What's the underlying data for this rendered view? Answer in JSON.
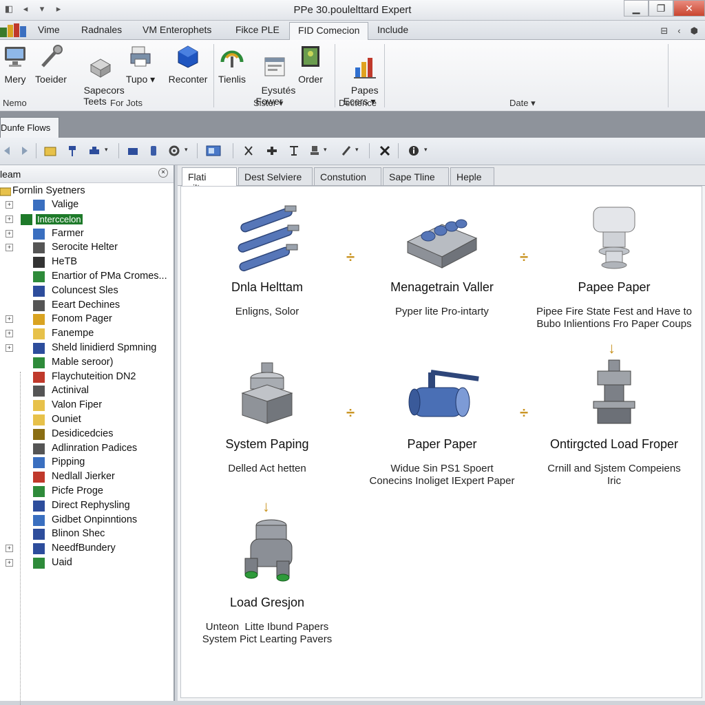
{
  "app": {
    "title": "PPe 30.poulelttard Expert"
  },
  "ribbon_tabs": [
    "Vime",
    "Radnales",
    "VM Enterophets",
    "Fikce PLE",
    "FID Comecion",
    "Include"
  ],
  "ribbon": {
    "buttons": [
      {
        "label": "Mery",
        "icon": "monitor-icon"
      },
      {
        "label": "Toeider",
        "icon": "wrench-icon"
      },
      {
        "label": "Sapecors\nTeets",
        "icon": "box-icon"
      },
      {
        "label": "Tupo ▾",
        "icon": "printer-icon"
      },
      {
        "label": "Reconter",
        "icon": "cube-icon"
      },
      {
        "label": "Tienlis",
        "icon": "gauge-icon"
      },
      {
        "label": "Eysutés\nFower",
        "icon": "window-icon"
      },
      {
        "label": "Order",
        "icon": "photo-icon"
      },
      {
        "label": "Papes\nEcers ▾",
        "icon": "chart-icon"
      }
    ],
    "groups": [
      "Nemo",
      "For Jots",
      "Sister ▾",
      "Dectence",
      "Date ▾"
    ]
  },
  "doc_tab": "Dunfe Flows",
  "tree": {
    "header": "leam",
    "root": "Fornlin Syetners",
    "items": [
      {
        "label": "Valige",
        "expander": true
      },
      {
        "label": "Interccelon",
        "expander": true,
        "selected": true
      },
      {
        "label": "Farmer",
        "expander": true
      },
      {
        "label": "Serocite Helter",
        "expander": true
      },
      {
        "label": "HeTB",
        "expander": false
      },
      {
        "label": "Enartior of PMa Cromes...",
        "expander": false
      },
      {
        "label": "Coluncest Sles",
        "expander": false
      },
      {
        "label": "Eeart Dechines",
        "expander": false
      },
      {
        "label": "Fonom Pager",
        "expander": true
      },
      {
        "label": "Fanempe",
        "expander": true
      },
      {
        "label": "Sheld linidierd Spmning",
        "expander": true
      },
      {
        "label": "Mable seroor)",
        "expander": false
      },
      {
        "label": "Flaychuteition DN2",
        "expander": false
      },
      {
        "label": "Actinival",
        "expander": false
      },
      {
        "label": "Valon Fiper",
        "expander": false
      },
      {
        "label": "Ouniet",
        "expander": false
      },
      {
        "label": "Desidicedcies",
        "expander": false
      },
      {
        "label": "Adlinration Padices",
        "expander": false
      },
      {
        "label": "Pipping",
        "expander": false
      },
      {
        "label": "Nedlall Jierker",
        "expander": false
      },
      {
        "label": "Picfe Proge",
        "expander": false
      },
      {
        "label": "Direct Rephysling",
        "expander": false
      },
      {
        "label": "Gidbet Onpinntions",
        "expander": false
      },
      {
        "label": "Blinon Shec",
        "expander": false
      },
      {
        "label": "NeedfBundery",
        "expander": true
      },
      {
        "label": "Uaid",
        "expander": true
      }
    ]
  },
  "content_tabs": [
    "Flati silten",
    "Dest Selviere",
    "Constution",
    "Sape Tline",
    "Heple"
  ],
  "components": [
    {
      "name": "Dnla Helttam",
      "desc": "Enligns, Solor",
      "icon": "pipes-icon"
    },
    {
      "name": "Menagetrain Valler",
      "desc": "Pyper lite Pro-intarty",
      "icon": "pump-icon"
    },
    {
      "name": "Papee Paper",
      "desc": "Pipee Fire State Fest and Have to\nBubo Inlientions Fro Paper Coups",
      "icon": "valve-top-icon"
    },
    {
      "name": "System Paping",
      "desc": "Delled Act hetten",
      "icon": "motor-icon"
    },
    {
      "name": "Paper Paper",
      "desc": "Widue Sin PS1 Spoert\nConecins Inoliget IExpert Paper",
      "icon": "ball-valve-icon"
    },
    {
      "name": "Ontirgcted Load Froper",
      "desc": "Crnill and Sjstem Compeiens\nIric",
      "icon": "actuator-icon"
    },
    {
      "name": "Load Gresjon",
      "desc": "Unteon  Litte Ibund Papers\nSystem Pict Learting Pavers",
      "icon": "fitting-icon"
    }
  ],
  "colors": {
    "selection": "#1e7a2a",
    "arrow": "#c8911c",
    "pipe_blue": "#4a6fb5"
  }
}
